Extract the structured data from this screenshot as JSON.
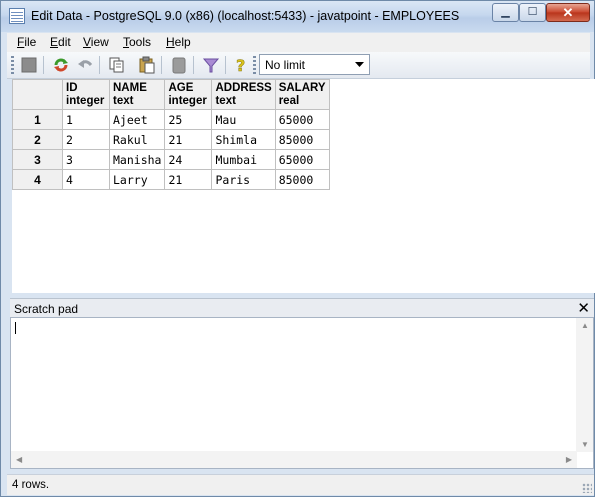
{
  "window": {
    "title": "Edit Data - PostgreSQL 9.0 (x86) (localhost:5433) - javatpoint - EMPLOYEES",
    "minimize_label": "▁",
    "maximize_label": "☐",
    "close_label": "✕"
  },
  "menu": {
    "items": [
      {
        "label": "File",
        "mnemonic": "F"
      },
      {
        "label": "Edit",
        "mnemonic": "E"
      },
      {
        "label": "View",
        "mnemonic": "V"
      },
      {
        "label": "Tools",
        "mnemonic": "T"
      },
      {
        "label": "Help",
        "mnemonic": "H"
      }
    ]
  },
  "toolbar": {
    "buttons": [
      "save-icon",
      "refresh-icon",
      "undo-icon",
      "copy-icon",
      "paste-icon",
      "delete-icon",
      "filter-icon",
      "help-icon"
    ],
    "row_limit": "No limit"
  },
  "grid": {
    "columns": [
      {
        "name": "ID",
        "type": "integer"
      },
      {
        "name": "NAME",
        "type": "text"
      },
      {
        "name": "AGE",
        "type": "integer"
      },
      {
        "name": "ADDRESS",
        "type": "text"
      },
      {
        "name": "SALARY",
        "type": "real"
      }
    ],
    "rows": [
      {
        "num": "1",
        "cells": [
          "1",
          "Ajeet",
          "25",
          "Mau",
          "65000"
        ]
      },
      {
        "num": "2",
        "cells": [
          "2",
          "Rakul",
          "21",
          "Shimla",
          "85000"
        ]
      },
      {
        "num": "3",
        "cells": [
          "3",
          "Manisha",
          "24",
          "Mumbai",
          "65000"
        ]
      },
      {
        "num": "4",
        "cells": [
          "4",
          "Larry",
          "21",
          "Paris",
          "85000"
        ]
      }
    ]
  },
  "scratch_pad": {
    "title": "Scratch pad",
    "close_label": "✕",
    "content": ""
  },
  "status": {
    "text": "4 rows."
  },
  "colors": {
    "window_frame": "#d9e4f1",
    "close_button": "#c9452c",
    "grid_header": "#f0f0f0"
  }
}
